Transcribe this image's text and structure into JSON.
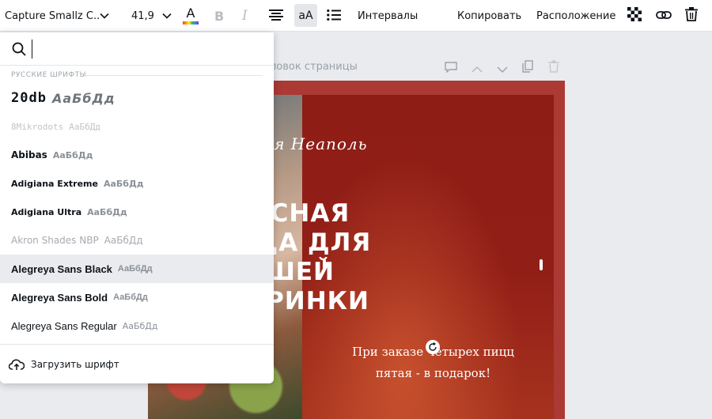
{
  "toolbar": {
    "font_family": "Capture Smallz C...",
    "font_size": "41,9",
    "color_letter": "A",
    "bold_label": "B",
    "italic_label": "I",
    "case_label": "aA",
    "spacing_label": "Интервалы",
    "copy_label": "Копировать",
    "position_label": "Расположение",
    "icons": [
      "chevron-down-icon",
      "text-color-icon",
      "bold-icon",
      "italic-icon",
      "align-center-icon",
      "list-icon",
      "transparency-icon",
      "link-icon",
      "trash-icon"
    ]
  },
  "page": {
    "title_partial": "ловок страницы",
    "tools": [
      "comment-icon",
      "chevron-up-icon",
      "chevron-down-icon",
      "duplicate-icon",
      "trash-icon"
    ]
  },
  "design": {
    "pizzeria": "Пиццерия Неаполь",
    "headline_lines": [
      "ВКУСНАЯ",
      "ПИЦЦА ДЛЯ",
      "ВАШЕЙ",
      "ВЕЧЕРИНКИ"
    ],
    "promo_lines": [
      "При заказе четырех пицц",
      "пятая - в подарок!"
    ],
    "accent_color": "#aa3a33",
    "panel_color": "#8e1d16"
  },
  "font_panel": {
    "search_value": "",
    "section_label": "РУССКИЕ ШРИФТЫ",
    "fonts": [
      {
        "name": "20db",
        "sample": "АаБбДд"
      },
      {
        "name": "8Mikrodots",
        "sample": "АаБбДд"
      },
      {
        "name": "Abibas",
        "sample": "АаБбДд"
      },
      {
        "name": "Adigiana Extreme",
        "sample": "АаБбДд"
      },
      {
        "name": "Adigiana Ultra",
        "sample": "АаБбДд"
      },
      {
        "name": "Akron Shades NBP",
        "sample": "АаБбДд"
      },
      {
        "name": "Alegreya Sans Black",
        "sample": "АаБбДд",
        "selected": true
      },
      {
        "name": "Alegreya Sans Bold",
        "sample": "АаБбДд"
      },
      {
        "name": "Alegreya Sans Regular",
        "sample": "АаБбДд"
      }
    ],
    "upload_label": "Загрузить шрифт"
  }
}
